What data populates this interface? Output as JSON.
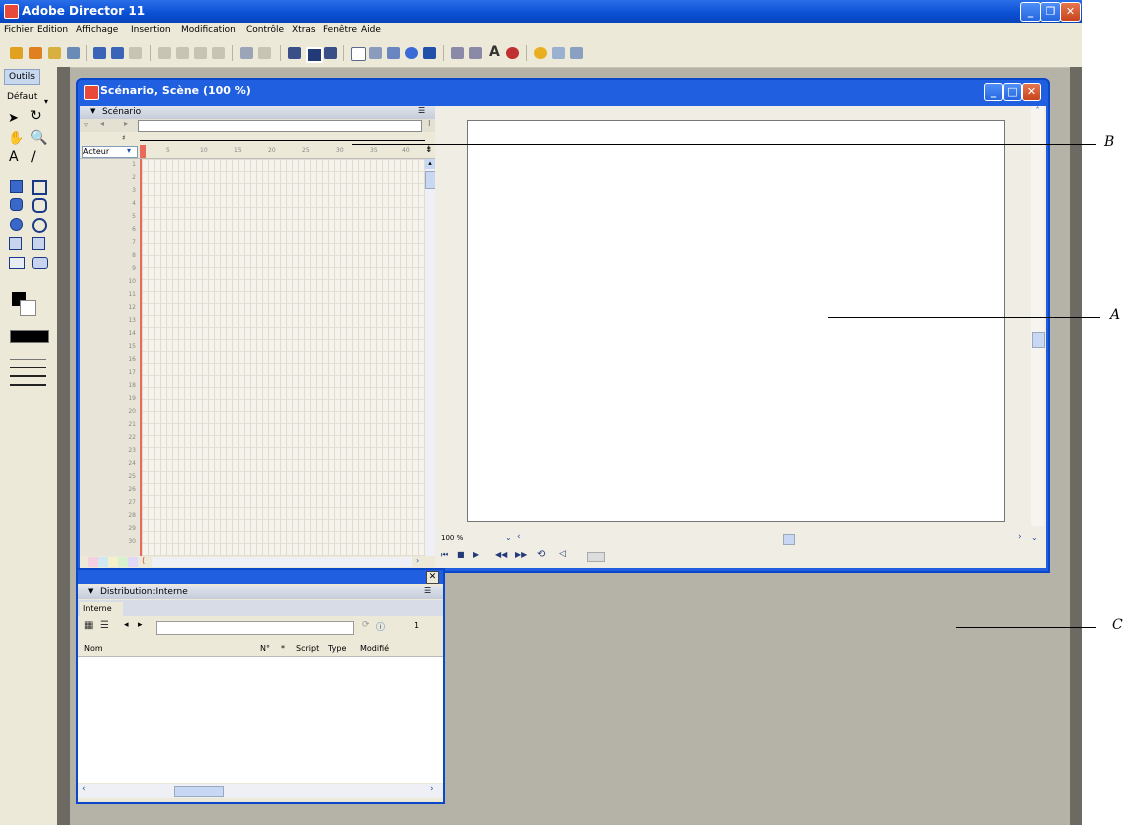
{
  "app": {
    "title": "Adobe Director 11",
    "menu": [
      "Fichier",
      "Edition",
      "Affichage",
      "Insertion",
      "Modification",
      "Contrôle",
      "Xtras",
      "Fenêtre",
      "Aide"
    ],
    "window_controls": [
      "minimize-icon",
      "restore-icon",
      "close-icon"
    ]
  },
  "tools": {
    "tab_label": "Outils",
    "default_label": "Défaut",
    "icons": [
      "arrow-icon",
      "rotate-icon",
      "hand-icon",
      "zoom-icon",
      "text-icon",
      "line-icon",
      "filled-rect-icon",
      "rect-icon",
      "filled-ellipse-icon",
      "ellipse-icon",
      "filled-circle-icon",
      "circle-icon",
      "checkbox-icon",
      "radio-icon",
      "field-icon",
      "button-icon"
    ]
  },
  "score_window": {
    "title": "Scénario, Scène (100 %)",
    "score_panel_title": "Scénario",
    "channel_dropdown": "Acteur",
    "frame_ruler": [
      "5",
      "10",
      "15",
      "20",
      "25",
      "30",
      "35",
      "40"
    ],
    "channel_numbers": [
      "1",
      "2",
      "3",
      "4",
      "5",
      "6",
      "7",
      "8",
      "9",
      "10",
      "11",
      "12",
      "13",
      "14",
      "15",
      "16",
      "17",
      "18",
      "19",
      "20",
      "21",
      "22",
      "23",
      "24",
      "25",
      "26",
      "27",
      "28",
      "29",
      "30"
    ],
    "zoom_value": "100 %"
  },
  "cast_window": {
    "title": "Distribution:Interne",
    "tab": "Interne",
    "member_num": "1",
    "columns": [
      "Nom",
      "N°",
      "*",
      "Script",
      "Type",
      "Modifié"
    ]
  },
  "callouts": {
    "a": "A",
    "b": "B",
    "c": "C"
  },
  "colors": {
    "titlebar_blue": "#0a4fd4",
    "workspace_gray": "#b5b2a8",
    "panel_beige": "#ece9d8"
  }
}
